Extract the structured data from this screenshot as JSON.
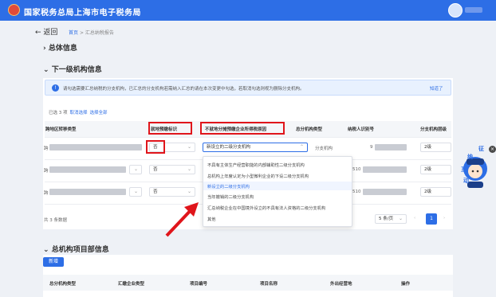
{
  "header": {
    "app_title": "国家税务总局上海市电子税务局"
  },
  "nav": {
    "back": "返回",
    "breadcrumb_home": "首页",
    "breadcrumb_sep": ">",
    "breadcrumb_current": "汇总纳税报告"
  },
  "sections": {
    "general": "总体信息",
    "branches": "下一级机构信息",
    "projects": "总机构项目部信息"
  },
  "notice": {
    "text": "请勾选需要汇总纳税的分支机构，已汇总的分支机构若需纳入汇总的请在本次变更中勾选，若取消勾选则视为删除分支机构。",
    "link": "知道了"
  },
  "selection": {
    "selected": "已选 3 项",
    "cancel": "取消选择",
    "select_all": "选择全部"
  },
  "columns": [
    "跨地区转移类型",
    "就地预缴标识",
    "不就地分摊预缴企业所得税原因",
    "总分机构类型",
    "纳税人识别号",
    "分支机构层级"
  ],
  "rows": [
    {
      "prefix": "跨",
      "prepay": "否",
      "reason": "新设立的二级分支机构",
      "type": "分支机构",
      "id": "9",
      "level": "2级"
    },
    {
      "prefix": "跨",
      "prepay": "否",
      "reason": "",
      "type": "",
      "id": "510",
      "level": "2级"
    },
    {
      "prefix": "跨",
      "prepay": "否",
      "reason": "",
      "type": "",
      "id": "510",
      "level": "2级"
    }
  ],
  "dropdown_options": [
    "不具有主体生产经营职能的内部辅助性二级分支机构",
    "总机构上年度认定为小型微利企业的下设二级分支机构",
    "新设立的二级分支机构",
    "当年撤销的二级分支机构",
    "汇总纳税企业在中国境外设立的不具有法人资格的二级分支机构",
    "其他"
  ],
  "dropdown_selected_index": 2,
  "pagination": {
    "total": "共 3 条数据",
    "per_page": "5 条/页",
    "current": "1"
  },
  "projects_table": {
    "new_button": "新增",
    "columns": [
      "总分机构类型",
      "汇缴企业类型",
      "项目编号",
      "项目名称",
      "外出经营地",
      "操作"
    ]
  },
  "mascot": {
    "text1": "征",
    "text2": "纳",
    "text3": "互",
    "text4": "动"
  },
  "colors": {
    "primary": "#2d6ee6",
    "highlight": "#e0151b"
  }
}
